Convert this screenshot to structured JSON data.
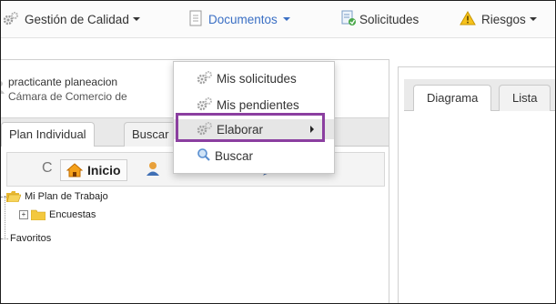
{
  "nav": {
    "items": [
      {
        "label": "Gestión de Calidad",
        "icon": "gears-icon"
      },
      {
        "label": "Documentos",
        "icon": "document-icon"
      },
      {
        "label": "Solicitudes",
        "icon": "request-icon"
      },
      {
        "label": "Riesgos",
        "icon": "warning-icon"
      }
    ]
  },
  "user": {
    "name": "practicante planeacion",
    "org": "Cámara de Comercio de"
  },
  "left_tabs": [
    {
      "label": "Plan Individual"
    },
    {
      "label": "Buscar"
    }
  ],
  "toolbar": {
    "refresh_glyph": "C",
    "home_label": "Inicio"
  },
  "tree": {
    "items": [
      {
        "label": "Mi Plan de Trabajo"
      },
      {
        "label": "Encuestas"
      },
      {
        "label": "Favoritos"
      }
    ]
  },
  "right_tabs": [
    {
      "label": "Diagrama"
    },
    {
      "label": "Lista"
    }
  ],
  "dropdown": {
    "items": [
      {
        "label": "Mis solicitudes",
        "icon": "gear-icon"
      },
      {
        "label": "Mis pendientes",
        "icon": "gear-icon"
      },
      {
        "label": "Elaborar",
        "icon": "gear-icon"
      },
      {
        "label": "Buscar",
        "icon": "search-icon"
      }
    ]
  },
  "colors": {
    "accent": "#3a6fc4",
    "highlight": "#8b3fa0",
    "menu_hover": "#e6e6e6"
  }
}
